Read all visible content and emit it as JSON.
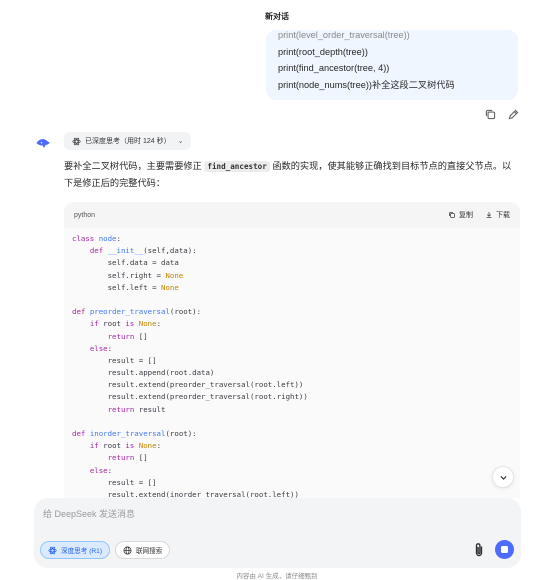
{
  "header": {
    "title": "新对话"
  },
  "user_message": {
    "lines": [
      "print(level_order_traversal(tree))",
      "print(root_depth(tree))",
      "print(find_ancestor(tree, 4))",
      "print(node_nums(tree))补全这段二叉树代码"
    ]
  },
  "message_actions": {
    "copy_icon": "copy-icon",
    "edit_icon": "edit-icon"
  },
  "assistant": {
    "avatar_icon": "deepseek-whale-icon",
    "think_chip": {
      "label": "已深度思考（用时 124 秒）",
      "icon": "atom-icon"
    },
    "answer": {
      "before_code": "要补全二叉树代码，主要需要修正 ",
      "inline_code": "find_ancestor",
      "after_code": " 函数的实现，使其能够正确找到目标节点的直接父节点。以下是修正后的完整代码："
    }
  },
  "code_block": {
    "language": "python",
    "copy_label": "复制",
    "download_label": "下载",
    "lines": [
      [
        {
          "t": "class",
          "c": "kw"
        },
        {
          "t": " "
        },
        {
          "t": "node",
          "c": "fn"
        },
        {
          "t": ":"
        }
      ],
      [
        {
          "t": "    "
        },
        {
          "t": "def",
          "c": "kw"
        },
        {
          "t": " "
        },
        {
          "t": "__init__",
          "c": "fn"
        },
        {
          "t": "(self,data):"
        }
      ],
      [
        {
          "t": "        self.data = data"
        }
      ],
      [
        {
          "t": "        self.right = "
        },
        {
          "t": "None",
          "c": "cn"
        }
      ],
      [
        {
          "t": "        self.left = "
        },
        {
          "t": "None",
          "c": "cn"
        }
      ],
      [
        {
          "t": ""
        }
      ],
      [
        {
          "t": "def",
          "c": "kw"
        },
        {
          "t": " "
        },
        {
          "t": "preorder_traversal",
          "c": "fn"
        },
        {
          "t": "(root):"
        }
      ],
      [
        {
          "t": "    "
        },
        {
          "t": "if",
          "c": "kw"
        },
        {
          "t": " root "
        },
        {
          "t": "is",
          "c": "kw"
        },
        {
          "t": " "
        },
        {
          "t": "None",
          "c": "cn"
        },
        {
          "t": ":"
        }
      ],
      [
        {
          "t": "        "
        },
        {
          "t": "return",
          "c": "kw"
        },
        {
          "t": " []"
        }
      ],
      [
        {
          "t": "    "
        },
        {
          "t": "else",
          "c": "kw"
        },
        {
          "t": ":"
        }
      ],
      [
        {
          "t": "        result = []"
        }
      ],
      [
        {
          "t": "        result.append(root.data)"
        }
      ],
      [
        {
          "t": "        result.extend(preorder_traversal(root.left))"
        }
      ],
      [
        {
          "t": "        result.extend(preorder_traversal(root.right))"
        }
      ],
      [
        {
          "t": "        "
        },
        {
          "t": "return",
          "c": "kw"
        },
        {
          "t": " result"
        }
      ],
      [
        {
          "t": ""
        }
      ],
      [
        {
          "t": "def",
          "c": "kw"
        },
        {
          "t": " "
        },
        {
          "t": "inorder_traversal",
          "c": "fn"
        },
        {
          "t": "(root):"
        }
      ],
      [
        {
          "t": "    "
        },
        {
          "t": "if",
          "c": "kw"
        },
        {
          "t": " root "
        },
        {
          "t": "is",
          "c": "kw"
        },
        {
          "t": " "
        },
        {
          "t": "None",
          "c": "cn"
        },
        {
          "t": ":"
        }
      ],
      [
        {
          "t": "        "
        },
        {
          "t": "return",
          "c": "kw"
        },
        {
          "t": " []"
        }
      ],
      [
        {
          "t": "    "
        },
        {
          "t": "else",
          "c": "kw"
        },
        {
          "t": ":"
        }
      ],
      [
        {
          "t": "        result = []"
        }
      ],
      [
        {
          "t": "        result.extend(inorder_traversal(root.left))"
        }
      ]
    ]
  },
  "composer": {
    "placeholder": "给 DeepSeek 发送消息",
    "deep_think_label": "深度思考 (R1)",
    "web_search_label": "联网搜索",
    "attach_icon": "paperclip-icon",
    "send_icon": "stop-icon"
  },
  "footer": {
    "note": "内容由 AI 生成，请仔细甄别"
  },
  "colors": {
    "accent": "#4d6bfe",
    "user_bubble": "#eff6ff",
    "deep_think_bg": "#dbeafe"
  }
}
